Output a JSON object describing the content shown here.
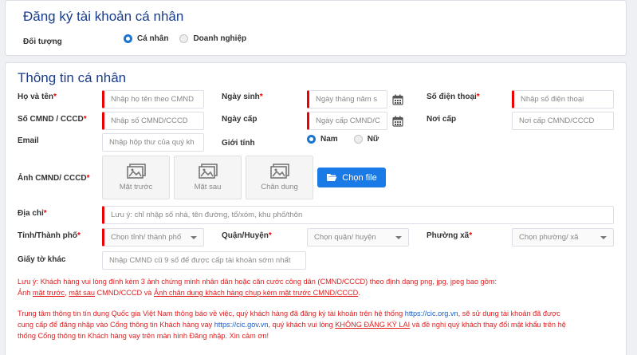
{
  "header": {
    "title": "Đăng ký tài khoản cá nhân",
    "audience_label": "Đối tượng",
    "options": [
      {
        "label": "Cá nhân",
        "selected": true
      },
      {
        "label": "Doanh nghiệp",
        "selected": false
      }
    ]
  },
  "section": {
    "title": "Thông tin cá nhân"
  },
  "fields": {
    "fullname": {
      "label": "Họ và tên",
      "placeholder": "Nhập họ tên theo CMND"
    },
    "dob": {
      "label": "Ngày sinh",
      "placeholder": "Ngày tháng năm s"
    },
    "phone": {
      "label": "Số điện thoại",
      "placeholder": "Nhập số điện thoại"
    },
    "idnum": {
      "label": "Số CMND / CCCD",
      "placeholder": "Nhập số CMND/CCCD"
    },
    "issue_date": {
      "label": "Ngày cấp",
      "placeholder": "Ngày cấp CMND/C"
    },
    "issue_place": {
      "label": "Nơi cấp",
      "placeholder": "Nơi cấp CMND/CCCD"
    },
    "email": {
      "label": "Email",
      "placeholder": "Nhập hộp thư của quý kh"
    },
    "gender": {
      "label": "Giới tính",
      "options": [
        {
          "label": "Nam",
          "selected": true
        },
        {
          "label": "Nữ",
          "selected": false
        }
      ]
    },
    "photos": {
      "label": "Ảnh CMND/ CCCD",
      "items": [
        "Mặt trước",
        "Mặt sau",
        "Chân dung"
      ],
      "button": "Chọn file"
    },
    "address": {
      "label": "Địa chỉ",
      "placeholder": "Lưu ý: chỉ nhập số nhà, tên đường, tổ/xóm, khu phố/thôn"
    },
    "province": {
      "label": "Tỉnh/Thành phố",
      "placeholder": "Chọn tỉnh/ thành phố"
    },
    "district": {
      "label": "Quận/Huyện",
      "placeholder": "Chọn quận/ huyện"
    },
    "ward": {
      "label": "Phường xã",
      "placeholder": "Chọn phường/ xã"
    },
    "other_doc": {
      "label": "Giấy tờ khác",
      "placeholder": "Nhập CMND cũ 9 số để được cấp tài khoản sớm nhất"
    }
  },
  "notes": {
    "n1_prefix": "Lưu ý: Khách hàng vui lòng đính kèm 3 ảnh chứng minh nhân dân hoặc căn cước công dân (CMND/CCCD) theo định dạng png, jpg, jpeg bao gồm:",
    "n1_l2_a": "Ảnh ",
    "n1_l2_u1": "mặt trước",
    "n1_l2_b": ", ",
    "n1_l2_u2": "mặt sau",
    "n1_l2_c": " CMND/CCCD và ",
    "n1_l2_u3": "Ảnh chân dung khách hàng chụp kèm mặt trước CMND/CCCD",
    "n1_l2_d": ".",
    "n2_a": "Trung tâm thông tin tín dụng Quốc gia Việt Nam thông báo về việc, quý khách hàng đã đăng ký tài khoản trên hệ thống ",
    "n2_link1": "https://cic.org.vn",
    "n2_b": ", sẽ sử dụng tài khoản đã được",
    "n2_c": "cung cấp để đăng nhập vào Cổng thông tin Khách hàng vay ",
    "n2_link2": "https://cic.gov.vn",
    "n2_d": ", quý khách vui lòng ",
    "n2_u": "KHÔNG ĐĂNG KÝ LẠI",
    "n2_e": " và đề nghị quý khách thay đổi mật khẩu trên hệ",
    "n2_f": "thống Cổng thông tin Khách hàng vay trên màn hình Đăng nhập. Xin cảm ơn!"
  },
  "colors": {
    "accent": "#1976d2",
    "required": "#e00000",
    "title": "#1a3c8c"
  }
}
